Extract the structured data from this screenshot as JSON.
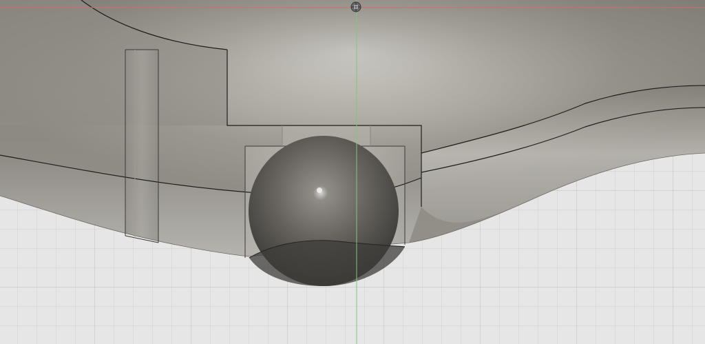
{
  "viewport": {
    "background_color": "#e6e6e6",
    "grid_color": "#c9c9c9",
    "grid_major_color": "#b9b9b9",
    "x_axis_color": "#d46a6a",
    "y_axis_color": "#7fc67f",
    "origin_icon": "origin-marker-icon"
  },
  "model": {
    "body_color": "#8a8780",
    "highlight_color": "#f7f6f2",
    "edge_color": "#1d1d1d",
    "sphere_color": "#55524d"
  }
}
